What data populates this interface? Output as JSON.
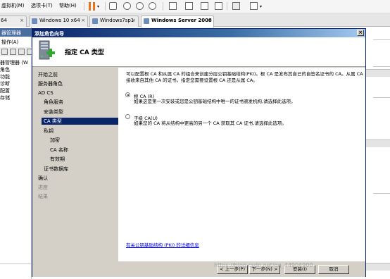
{
  "menubar": {
    "items": [
      "虚拟机(M)",
      "选项卡(T)",
      "帮助(H)"
    ]
  },
  "tabs": [
    {
      "label": "64"
    },
    {
      "label": "Windows 10 x64"
    },
    {
      "label": "Windows7sp1"
    },
    {
      "label": "Windows Server 2008"
    }
  ],
  "bg_window": {
    "title": "器管理器",
    "menu": "操作(A)",
    "tree": [
      "器管理器 (W",
      "角色",
      "功能",
      "诊断",
      "配置",
      "存储"
    ]
  },
  "dialog": {
    "title": "添加角色向导",
    "close_glyph": "×",
    "header_title": "指定 CA 类型",
    "nav": [
      {
        "label": "开始之前"
      },
      {
        "label": "服务器角色"
      },
      {
        "label": "AD CS"
      },
      {
        "label": "角色服务"
      },
      {
        "label": "安装类型"
      },
      {
        "label": "CA 类型"
      },
      {
        "label": "私钥"
      },
      {
        "label": "加密"
      },
      {
        "label": "CA 名称"
      },
      {
        "label": "有效期"
      },
      {
        "label": "证书数据库"
      },
      {
        "label": "确认"
      },
      {
        "label": "进度"
      },
      {
        "label": "结果"
      }
    ],
    "intro": "可以配置根 CA 和从属 CA 的组合来创建分层公钥基础结构(PKI)。根 CA 是发布其自己的自签名证书的 CA。从属 CA 接收来自其他 CA 的证书。指定您需要设置根 CA 还是从属 CA。",
    "options": [
      {
        "label": "根 CA (R)",
        "description": "如果这是第一次安装或您是公钥基础结构中唯一的证书颁发机构,请选择此选项。",
        "selected": true
      },
      {
        "label": "子级 CA(U)",
        "description": "如果您的 CA 将从结构中更高的另一个 CA 获取其 CA 证书,请选择此选项。",
        "selected": false
      }
    ],
    "link": "有关公钥基础结构 (PKI) 的详细信息",
    "buttons": {
      "prev": "< 上一步(P)",
      "next": "下一步(N) >",
      "install": "安装(I)",
      "cancel": "取消"
    }
  },
  "watermark": "https://blog.csdn.net/qq_44904900",
  "colors": {
    "title_bar": "#0a246a",
    "nav_selected": "#0a246a",
    "dialog_face": "#d4d0c8",
    "pause_orange": "#e8731a",
    "link_blue": "#0000ee"
  }
}
